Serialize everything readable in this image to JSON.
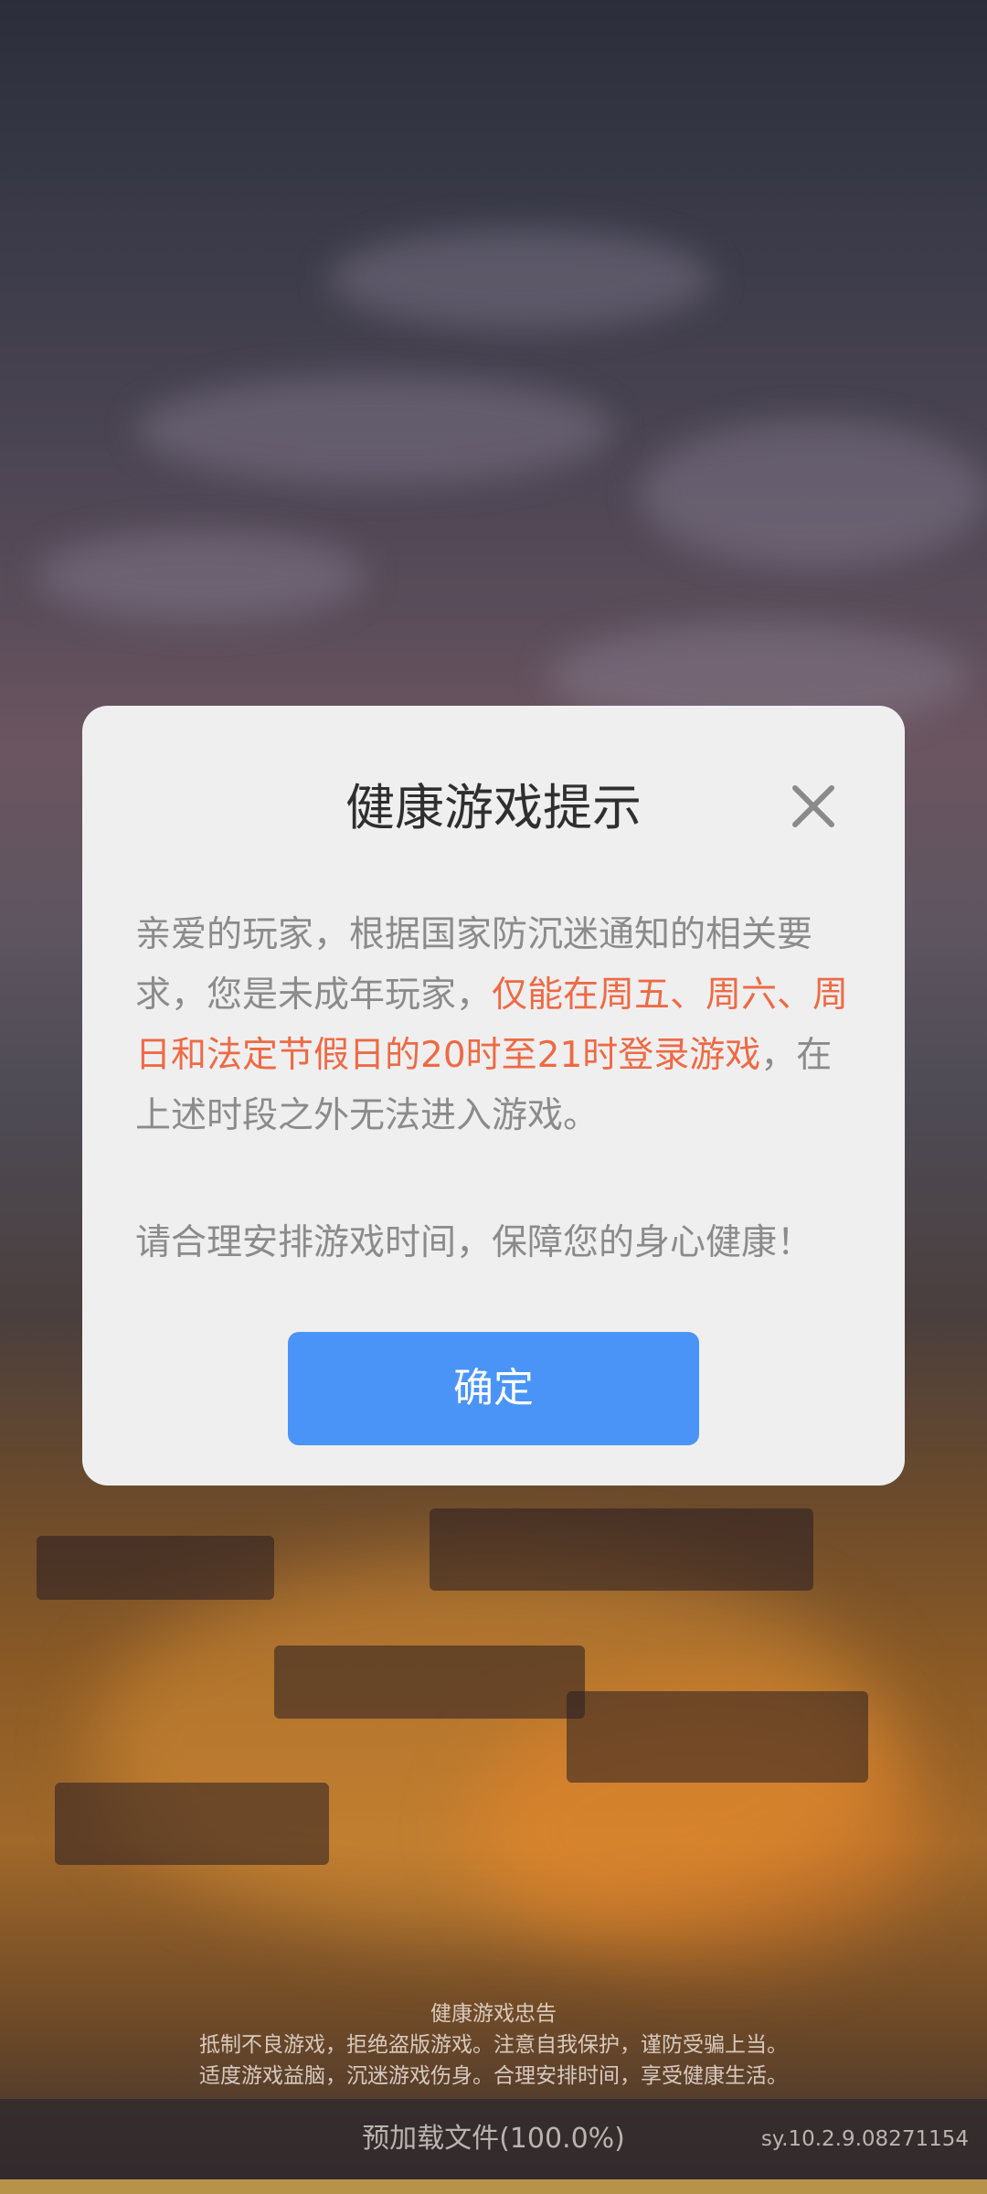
{
  "dialog": {
    "title": "健康游戏提示",
    "message_normal": "亲爱的玩家，根据国家防沉迷通知的相关要求，您是未成年玩家，",
    "message_highlight": "仅能在周五、周六、周日和法定节假日的20时至21时登录游戏",
    "message_tail": "，在上述时段之外无法进入游戏。",
    "reminder": "请合理安排游戏时间，保障您的身心健康！",
    "confirm_label": "确定",
    "close_icon": "close-icon"
  },
  "advisory": {
    "title": "健康游戏忠告",
    "line1": "抵制不良游戏，拒绝盗版游戏。注意自我保护，谨防受骗上当。",
    "line2": "适度游戏益脑，沉迷游戏伤身。合理安排时间，享受健康生活。"
  },
  "footer": {
    "preload_text": "预加载文件(100.0%)",
    "preload_progress": 1.0,
    "version": "sy.10.2.9.08271154"
  },
  "colors": {
    "accent": "#4a94f8",
    "highlight": "#ee6a45",
    "dialog_bg": "#efefef"
  }
}
